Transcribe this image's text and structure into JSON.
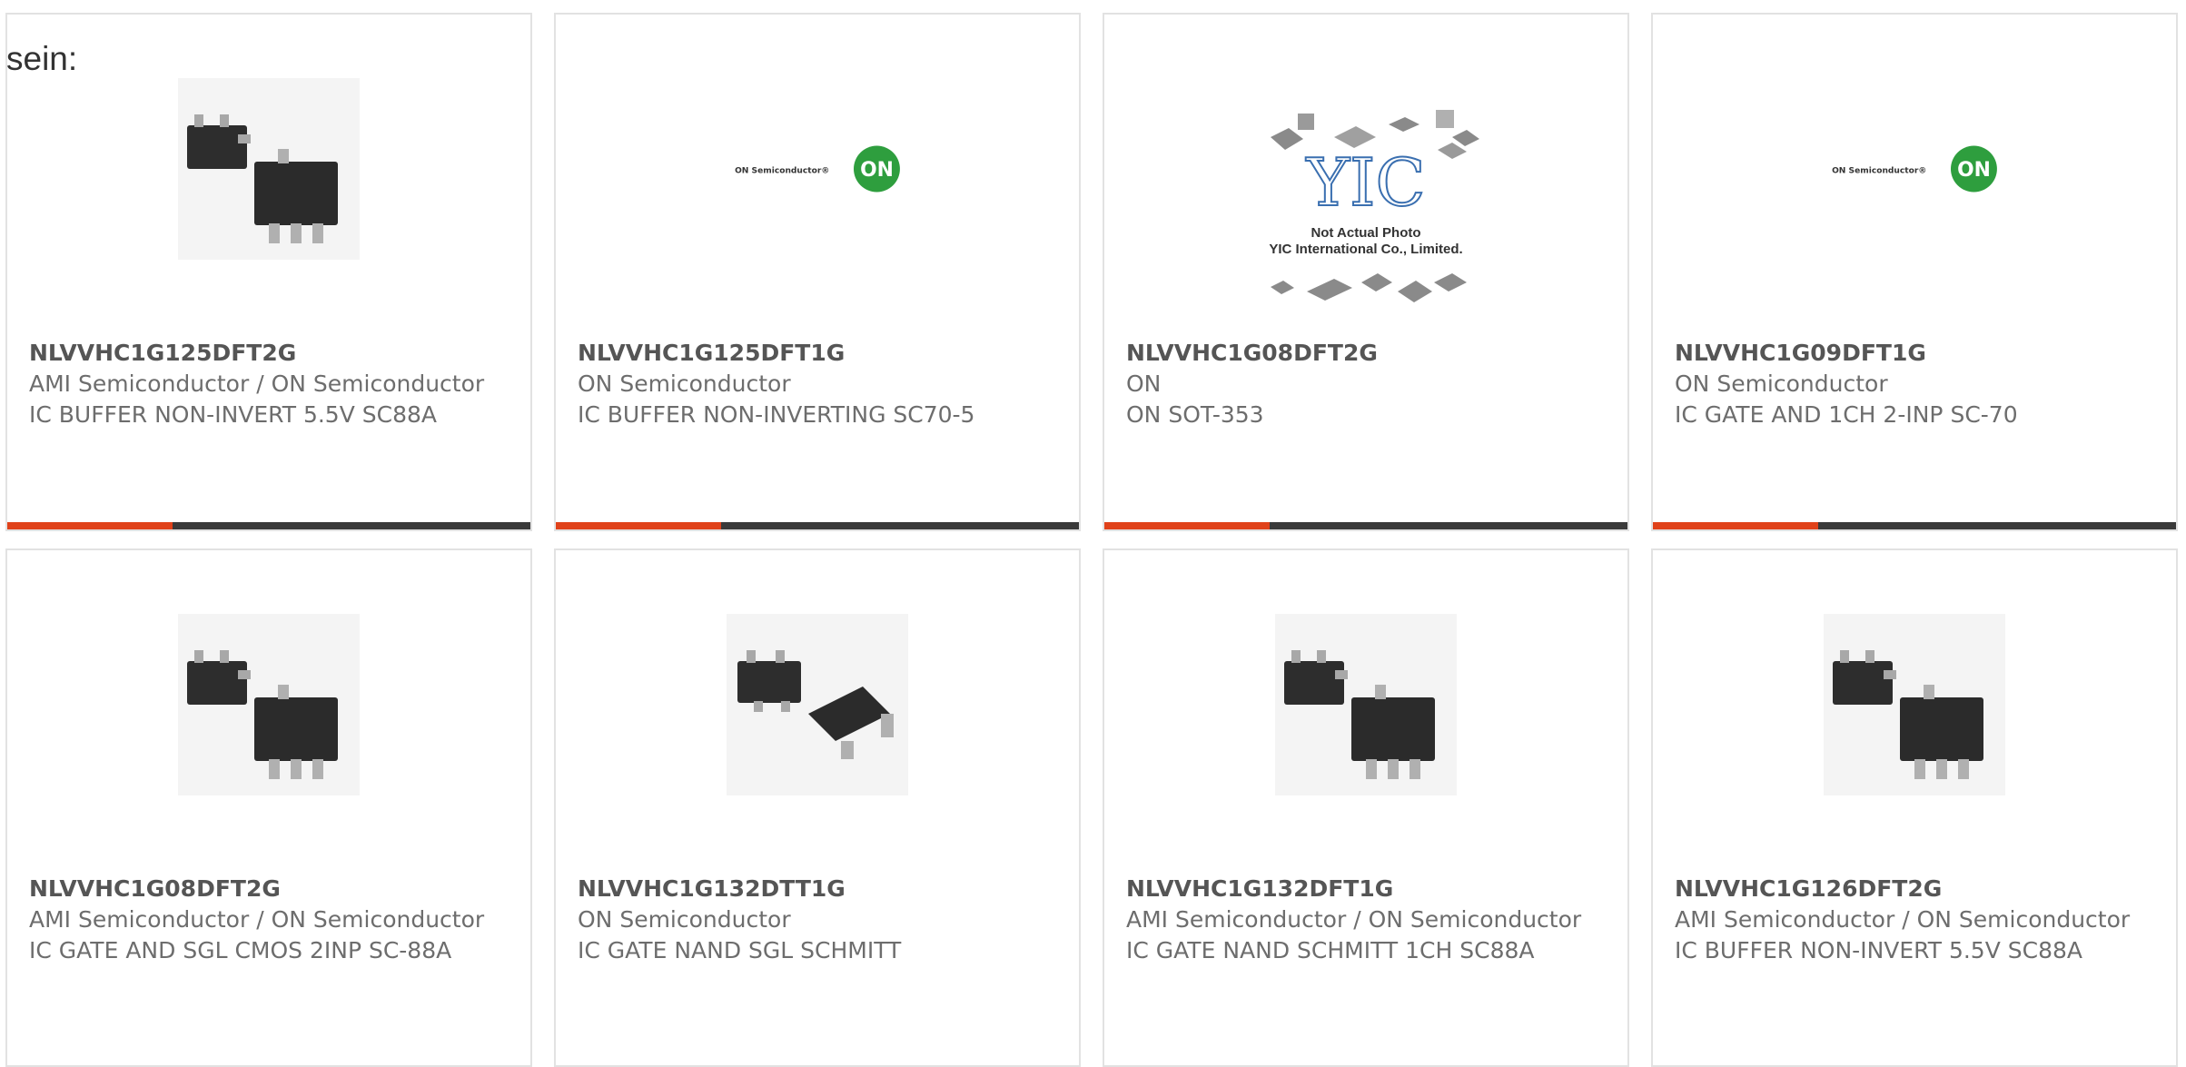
{
  "intro_text": "sein:",
  "products": [
    {
      "part_number": "NLVVHC1G125DFT2G",
      "manufacturer": "AMI Semiconductor / ON Semiconductor",
      "description": "IC BUFFER NON-INVERT 5.5V SC88A",
      "image": "ic-package-photo"
    },
    {
      "part_number": "NLVVHC1G125DFT1G",
      "manufacturer": "ON Semiconductor",
      "description": "IC BUFFER NON-INVERTING SC70-5",
      "image": "on-semiconductor-logo",
      "logo_text": "ON Semiconductor®",
      "logo_badge": "ON"
    },
    {
      "part_number": "NLVVHC1G08DFT2G",
      "manufacturer": "ON",
      "description": "ON SOT-353",
      "image": "not-actual-photo-placeholder",
      "placeholder_line1": "Not Actual Photo",
      "placeholder_line2": "YIC International Co., Limited.",
      "placeholder_logo": "YIC"
    },
    {
      "part_number": "NLVVHC1G09DFT1G",
      "manufacturer": "ON Semiconductor",
      "description": "IC GATE AND 1CH 2-INP SC-70",
      "image": "on-semiconductor-logo",
      "logo_text": "ON Semiconductor®",
      "logo_badge": "ON"
    },
    {
      "part_number": "NLVVHC1G08DFT2G",
      "manufacturer": "AMI Semiconductor / ON Semiconductor",
      "description": "IC GATE AND SGL CMOS 2INP SC-88A",
      "image": "ic-package-photo"
    },
    {
      "part_number": "NLVVHC1G132DTT1G",
      "manufacturer": "ON Semiconductor",
      "description": "IC GATE NAND SGL SCHMITT",
      "image": "ic-package-photo-alt"
    },
    {
      "part_number": "NLVVHC1G132DFT1G",
      "manufacturer": "AMI Semiconductor / ON Semiconductor",
      "description": "IC GATE NAND SCHMITT 1CH SC88A",
      "image": "ic-package-photo"
    },
    {
      "part_number": "NLVVHC1G126DFT2G",
      "manufacturer": "AMI Semiconductor / ON Semiconductor",
      "description": "IC BUFFER NON-INVERT 5.5V SC88A",
      "image": "ic-package-photo"
    }
  ],
  "colors": {
    "accent": "#e0421a",
    "bar": "#3a3a3a",
    "border": "#e2e2e2",
    "on_green": "#2e9e3e"
  }
}
